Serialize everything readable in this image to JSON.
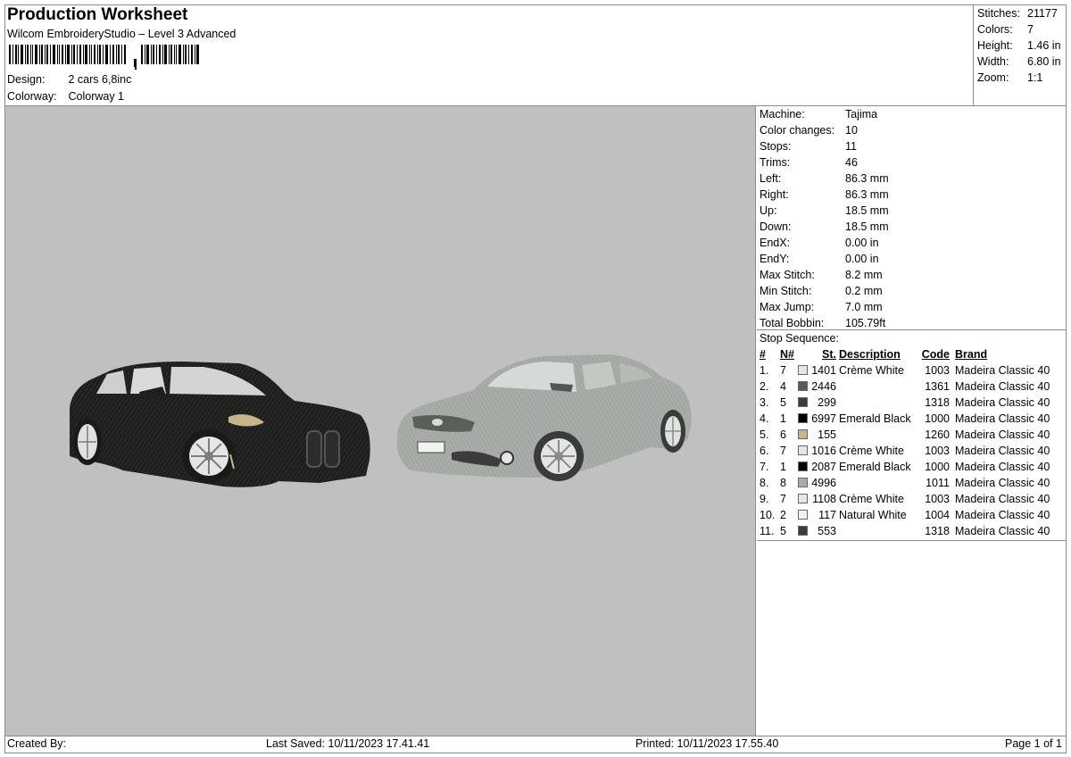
{
  "header": {
    "title": "Production Worksheet",
    "subtitle": "Wilcom EmbroideryStudio – Level 3 Advanced",
    "design_label": "Design:",
    "design_value": "2 cars 6,8inc",
    "colorway_label": "Colorway:",
    "colorway_value": "Colorway 1"
  },
  "summary": [
    {
      "label": "Stitches:",
      "value": "21177"
    },
    {
      "label": "Colors:",
      "value": "7"
    },
    {
      "label": "Height:",
      "value": "1.46 in"
    },
    {
      "label": "Width:",
      "value": "6.80 in"
    },
    {
      "label": "Zoom:",
      "value": "1:1"
    }
  ],
  "info": [
    {
      "label": "Machine:",
      "value": "Tajima"
    },
    {
      "label": "Color changes:",
      "value": "10"
    },
    {
      "label": "Stops:",
      "value": "11"
    },
    {
      "label": "Trims:",
      "value": "46"
    },
    {
      "label": "Left:",
      "value": "86.3 mm"
    },
    {
      "label": "Right:",
      "value": "86.3 mm"
    },
    {
      "label": "Up:",
      "value": "18.5 mm"
    },
    {
      "label": "Down:",
      "value": "18.5 mm"
    },
    {
      "label": "EndX:",
      "value": "0.00 in"
    },
    {
      "label": "EndY:",
      "value": "0.00 in"
    },
    {
      "label": "Max Stitch:",
      "value": "8.2 mm"
    },
    {
      "label": "Min Stitch:",
      "value": "0.2 mm"
    },
    {
      "label": "Max Jump:",
      "value": "7.0 mm"
    },
    {
      "label": "Total Bobbin:",
      "value": "105.79ft"
    }
  ],
  "stop_sequence": {
    "caption": "Stop Sequence:",
    "headers": {
      "num": "#",
      "n": "N#",
      "st": "St.",
      "desc": "Description",
      "code": "Code",
      "brand": "Brand"
    },
    "rows": [
      {
        "num": "1.",
        "n": "7",
        "color": "#e6e6e6",
        "st": "1401",
        "desc": "Crème White",
        "code": "1003",
        "brand": "Madeira Classic 40"
      },
      {
        "num": "2.",
        "n": "4",
        "color": "#5a5a5a",
        "st": "2446",
        "desc": "",
        "code": "1361",
        "brand": "Madeira Classic 40"
      },
      {
        "num": "3.",
        "n": "5",
        "color": "#3c3c3c",
        "st": "299",
        "desc": "",
        "code": "1318",
        "brand": "Madeira Classic 40"
      },
      {
        "num": "4.",
        "n": "1",
        "color": "#000000",
        "st": "6997",
        "desc": "Emerald Black",
        "code": "1000",
        "brand": "Madeira Classic 40"
      },
      {
        "num": "5.",
        "n": "6",
        "color": "#c6b48c",
        "st": "155",
        "desc": "",
        "code": "1260",
        "brand": "Madeira Classic 40"
      },
      {
        "num": "6.",
        "n": "7",
        "color": "#e6e6e6",
        "st": "1016",
        "desc": "Crème White",
        "code": "1003",
        "brand": "Madeira Classic 40"
      },
      {
        "num": "7.",
        "n": "1",
        "color": "#000000",
        "st": "2087",
        "desc": "Emerald Black",
        "code": "1000",
        "brand": "Madeira Classic 40"
      },
      {
        "num": "8.",
        "n": "8",
        "color": "#a9aca9",
        "st": "4996",
        "desc": "",
        "code": "1011",
        "brand": "Madeira Classic 40"
      },
      {
        "num": "9.",
        "n": "7",
        "color": "#e6e6e6",
        "st": "1108",
        "desc": "Crème White",
        "code": "1003",
        "brand": "Madeira Classic 40"
      },
      {
        "num": "10.",
        "n": "2",
        "color": "#f2f2f2",
        "st": "117",
        "desc": "Natural White",
        "code": "1004",
        "brand": "Madeira Classic 40"
      },
      {
        "num": "11.",
        "n": "5",
        "color": "#3c3c3c",
        "st": "553",
        "desc": "",
        "code": "1318",
        "brand": "Madeira Classic 40"
      }
    ]
  },
  "footer": {
    "created_by": "Created By:",
    "last_saved": "Last Saved: 10/11/2023 17.41.41",
    "printed": "Printed: 10/11/2023 17.55.40",
    "page": "Page 1 of 1"
  },
  "colors": {
    "preview_bg": "#c0c0c0",
    "black_car": "#1e1f1d",
    "silver_car": "#a8ada8",
    "border": "#8a8a8a"
  }
}
